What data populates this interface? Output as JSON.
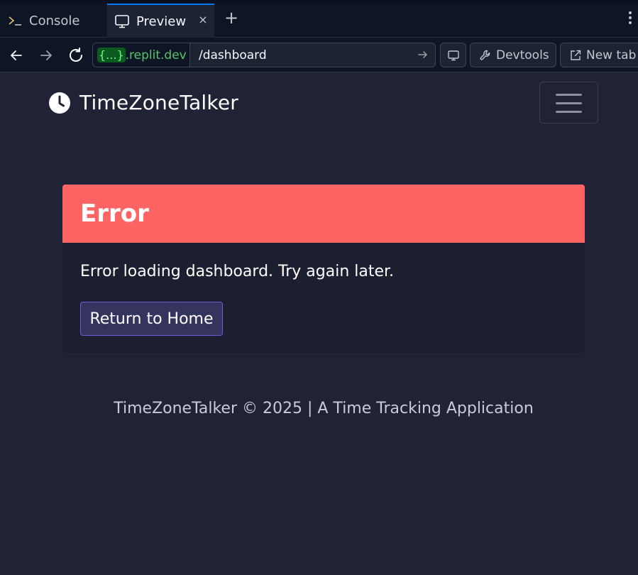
{
  "tabs": {
    "console_label": "Console",
    "preview_label": "Preview",
    "close_glyph": "×",
    "add_glyph": "+"
  },
  "address_bar": {
    "url_badge": "{...}",
    "url_domain": ".replit.dev",
    "url_path": "/dashboard",
    "devtools_label": "Devtools",
    "newtab_label": "New tab"
  },
  "app": {
    "brand_name": "TimeZoneTalker",
    "brand_icon": "clock-icon"
  },
  "error_card": {
    "title": "Error",
    "message": "Error loading dashboard. Try again later.",
    "button_label": "Return to Home",
    "header_color": "#ff6464"
  },
  "footer": {
    "text": "TimeZoneTalker © 2025 | A Time Tracking Application"
  }
}
